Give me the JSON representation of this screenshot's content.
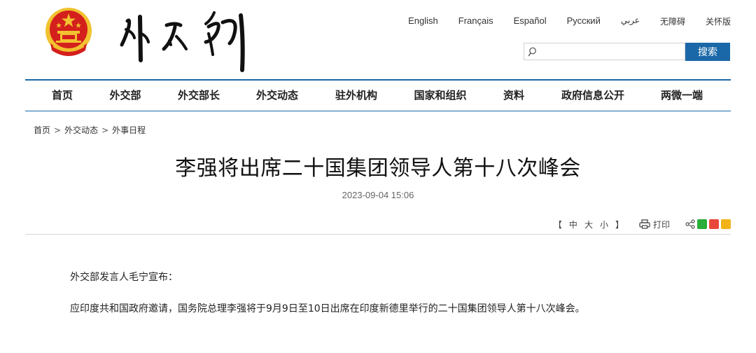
{
  "header": {
    "languages": [
      "English",
      "Français",
      "Español",
      "Русский",
      "عربي",
      "无障碍",
      "关怀版"
    ],
    "search": {
      "placeholder": "",
      "button_label": "搜索"
    }
  },
  "nav": {
    "items": [
      "首页",
      "外交部",
      "外交部长",
      "外交动态",
      "驻外机构",
      "国家和组织",
      "资料",
      "政府信息公开",
      "两微一端"
    ]
  },
  "breadcrumb": {
    "items": [
      "首页",
      "外交动态",
      "外事日程"
    ],
    "separator": ">"
  },
  "article": {
    "title": "李强将出席二十国集团领导人第十八次峰会",
    "date": "2023-09-04 15:06",
    "tools": {
      "bracket_open": "【",
      "size_large": "中",
      "size_medium": "大",
      "size_small": "小",
      "bracket_close": "】",
      "print_label": "打印"
    },
    "paragraphs": [
      "外交部发言人毛宁宣布：",
      "应印度共和国政府邀请，国务院总理李强将于9月9日至10日出席在印度新德里举行的二十国集团领导人第十八次峰会。"
    ]
  },
  "colors": {
    "brand_blue": "#1b68a8",
    "emblem_red": "#d4201c",
    "emblem_gold": "#f2c230"
  },
  "icons": [
    "national-emblem",
    "calligraphy-logo",
    "search-icon",
    "printer-icon",
    "share-icon",
    "wechat-icon",
    "weibo-icon",
    "qzone-icon"
  ]
}
